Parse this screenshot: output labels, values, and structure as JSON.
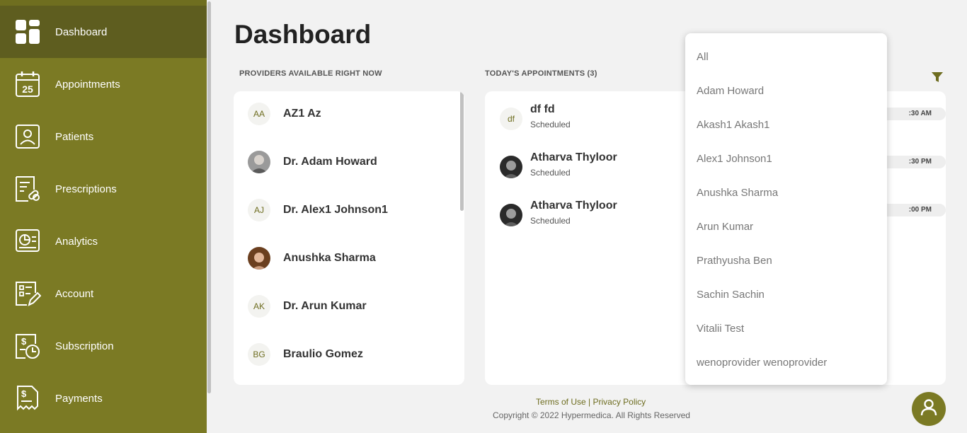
{
  "sidebar": {
    "items": [
      {
        "label": "Dashboard",
        "icon": "dashboard-icon",
        "active": true
      },
      {
        "label": "Appointments",
        "icon": "calendar-icon",
        "badge": "25"
      },
      {
        "label": "Patients",
        "icon": "patient-icon"
      },
      {
        "label": "Prescriptions",
        "icon": "prescription-icon"
      },
      {
        "label": "Analytics",
        "icon": "analytics-icon"
      },
      {
        "label": "Account",
        "icon": "account-icon"
      },
      {
        "label": "Subscription",
        "icon": "subscription-icon"
      },
      {
        "label": "Payments",
        "icon": "payments-icon"
      }
    ]
  },
  "main": {
    "title": "Dashboard",
    "providers_label": "PROVIDERS AVAILABLE RIGHT NOW",
    "appointments_label": "TODAY'S APPOINTMENTS (3)",
    "providers": [
      {
        "initials": "AA",
        "name": "AZ1 Az",
        "photo": false
      },
      {
        "initials": "",
        "name": "Dr. Adam Howard",
        "photo": true
      },
      {
        "initials": "AJ",
        "name": "Dr. Alex1 Johnson1",
        "photo": false
      },
      {
        "initials": "",
        "name": "Anushka Sharma",
        "photo": true
      },
      {
        "initials": "AK",
        "name": "Dr. Arun Kumar",
        "photo": false
      },
      {
        "initials": "BG",
        "name": "Braulio Gomez",
        "photo": false
      }
    ],
    "appointments": [
      {
        "initials": "df",
        "name": "df fd",
        "status": "Scheduled",
        "time": ":30 AM"
      },
      {
        "initials": "",
        "name": "Atharva Thyloor",
        "status": "Scheduled",
        "time": ":30 PM"
      },
      {
        "initials": "",
        "name": "Atharva Thyloor",
        "status": "Scheduled",
        "time": ":00 PM"
      }
    ]
  },
  "dropdown": {
    "options": [
      "All",
      "Adam Howard",
      "Akash1 Akash1",
      "Alex1 Johnson1",
      "Anushka Sharma",
      "Arun Kumar",
      "Prathyusha Ben",
      "Sachin Sachin",
      "Vitalii Test",
      "wenoprovider wenoprovider"
    ]
  },
  "footer": {
    "terms": "Terms of Use",
    "separator": " | ",
    "privacy": "Privacy Policy",
    "copyright": "Copyright © 2022 Hypermedica. All Rights Reserved"
  },
  "colors": {
    "sidebar": "#7b7a24",
    "sidebar_active": "#5e5d1f",
    "accent": "#6e6d20"
  }
}
